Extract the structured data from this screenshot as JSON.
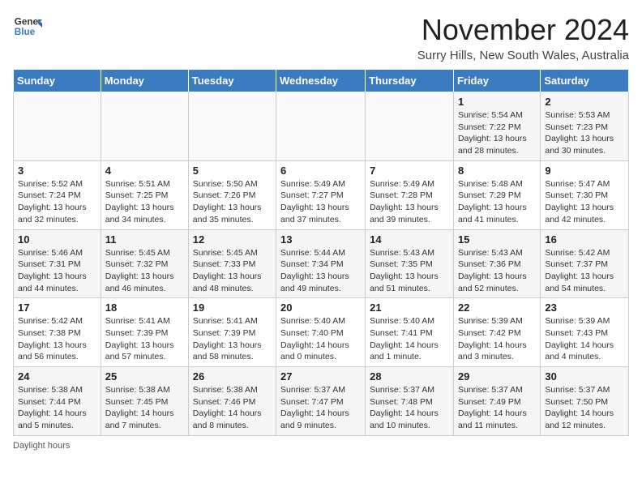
{
  "header": {
    "logo_general": "General",
    "logo_blue": "Blue",
    "title": "November 2024",
    "subtitle": "Surry Hills, New South Wales, Australia"
  },
  "days_of_week": [
    "Sunday",
    "Monday",
    "Tuesday",
    "Wednesday",
    "Thursday",
    "Friday",
    "Saturday"
  ],
  "footer": {
    "daylight_hours": "Daylight hours"
  },
  "weeks": [
    [
      {
        "day": "",
        "info": ""
      },
      {
        "day": "",
        "info": ""
      },
      {
        "day": "",
        "info": ""
      },
      {
        "day": "",
        "info": ""
      },
      {
        "day": "",
        "info": ""
      },
      {
        "day": "1",
        "info": "Sunrise: 5:54 AM\nSunset: 7:22 PM\nDaylight: 13 hours and 28 minutes."
      },
      {
        "day": "2",
        "info": "Sunrise: 5:53 AM\nSunset: 7:23 PM\nDaylight: 13 hours and 30 minutes."
      }
    ],
    [
      {
        "day": "3",
        "info": "Sunrise: 5:52 AM\nSunset: 7:24 PM\nDaylight: 13 hours and 32 minutes."
      },
      {
        "day": "4",
        "info": "Sunrise: 5:51 AM\nSunset: 7:25 PM\nDaylight: 13 hours and 34 minutes."
      },
      {
        "day": "5",
        "info": "Sunrise: 5:50 AM\nSunset: 7:26 PM\nDaylight: 13 hours and 35 minutes."
      },
      {
        "day": "6",
        "info": "Sunrise: 5:49 AM\nSunset: 7:27 PM\nDaylight: 13 hours and 37 minutes."
      },
      {
        "day": "7",
        "info": "Sunrise: 5:49 AM\nSunset: 7:28 PM\nDaylight: 13 hours and 39 minutes."
      },
      {
        "day": "8",
        "info": "Sunrise: 5:48 AM\nSunset: 7:29 PM\nDaylight: 13 hours and 41 minutes."
      },
      {
        "day": "9",
        "info": "Sunrise: 5:47 AM\nSunset: 7:30 PM\nDaylight: 13 hours and 42 minutes."
      }
    ],
    [
      {
        "day": "10",
        "info": "Sunrise: 5:46 AM\nSunset: 7:31 PM\nDaylight: 13 hours and 44 minutes."
      },
      {
        "day": "11",
        "info": "Sunrise: 5:45 AM\nSunset: 7:32 PM\nDaylight: 13 hours and 46 minutes."
      },
      {
        "day": "12",
        "info": "Sunrise: 5:45 AM\nSunset: 7:33 PM\nDaylight: 13 hours and 48 minutes."
      },
      {
        "day": "13",
        "info": "Sunrise: 5:44 AM\nSunset: 7:34 PM\nDaylight: 13 hours and 49 minutes."
      },
      {
        "day": "14",
        "info": "Sunrise: 5:43 AM\nSunset: 7:35 PM\nDaylight: 13 hours and 51 minutes."
      },
      {
        "day": "15",
        "info": "Sunrise: 5:43 AM\nSunset: 7:36 PM\nDaylight: 13 hours and 52 minutes."
      },
      {
        "day": "16",
        "info": "Sunrise: 5:42 AM\nSunset: 7:37 PM\nDaylight: 13 hours and 54 minutes."
      }
    ],
    [
      {
        "day": "17",
        "info": "Sunrise: 5:42 AM\nSunset: 7:38 PM\nDaylight: 13 hours and 56 minutes."
      },
      {
        "day": "18",
        "info": "Sunrise: 5:41 AM\nSunset: 7:39 PM\nDaylight: 13 hours and 57 minutes."
      },
      {
        "day": "19",
        "info": "Sunrise: 5:41 AM\nSunset: 7:39 PM\nDaylight: 13 hours and 58 minutes."
      },
      {
        "day": "20",
        "info": "Sunrise: 5:40 AM\nSunset: 7:40 PM\nDaylight: 14 hours and 0 minutes."
      },
      {
        "day": "21",
        "info": "Sunrise: 5:40 AM\nSunset: 7:41 PM\nDaylight: 14 hours and 1 minute."
      },
      {
        "day": "22",
        "info": "Sunrise: 5:39 AM\nSunset: 7:42 PM\nDaylight: 14 hours and 3 minutes."
      },
      {
        "day": "23",
        "info": "Sunrise: 5:39 AM\nSunset: 7:43 PM\nDaylight: 14 hours and 4 minutes."
      }
    ],
    [
      {
        "day": "24",
        "info": "Sunrise: 5:38 AM\nSunset: 7:44 PM\nDaylight: 14 hours and 5 minutes."
      },
      {
        "day": "25",
        "info": "Sunrise: 5:38 AM\nSunset: 7:45 PM\nDaylight: 14 hours and 7 minutes."
      },
      {
        "day": "26",
        "info": "Sunrise: 5:38 AM\nSunset: 7:46 PM\nDaylight: 14 hours and 8 minutes."
      },
      {
        "day": "27",
        "info": "Sunrise: 5:37 AM\nSunset: 7:47 PM\nDaylight: 14 hours and 9 minutes."
      },
      {
        "day": "28",
        "info": "Sunrise: 5:37 AM\nSunset: 7:48 PM\nDaylight: 14 hours and 10 minutes."
      },
      {
        "day": "29",
        "info": "Sunrise: 5:37 AM\nSunset: 7:49 PM\nDaylight: 14 hours and 11 minutes."
      },
      {
        "day": "30",
        "info": "Sunrise: 5:37 AM\nSunset: 7:50 PM\nDaylight: 14 hours and 12 minutes."
      }
    ]
  ]
}
